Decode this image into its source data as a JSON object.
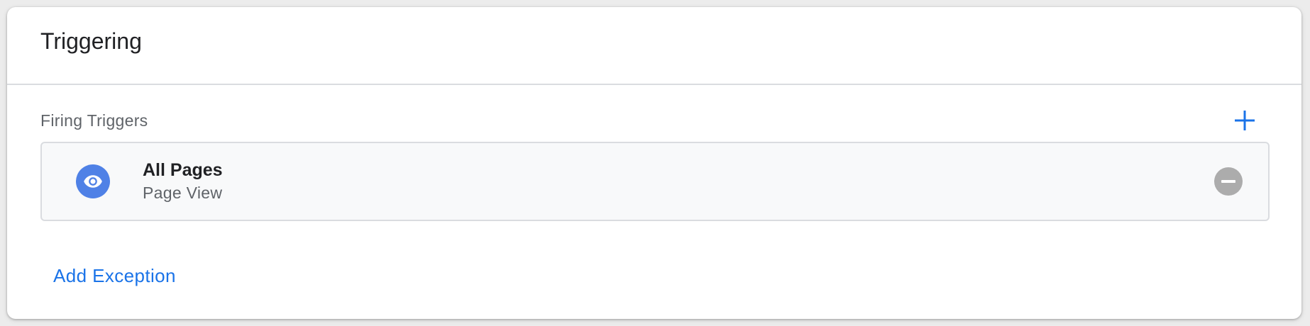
{
  "card": {
    "title": "Triggering"
  },
  "firing_triggers": {
    "label": "Firing Triggers",
    "add_icon": "plus-icon",
    "items": [
      {
        "name": "All Pages",
        "type": "Page View",
        "icon": "eye-icon",
        "remove_icon": "remove-circle-icon"
      }
    ]
  },
  "exceptions": {
    "add_label": "Add Exception"
  },
  "colors": {
    "accent": "#1a73e8",
    "trigger_icon_bg": "#4f81e6",
    "remove_icon_bg": "#acacac"
  }
}
